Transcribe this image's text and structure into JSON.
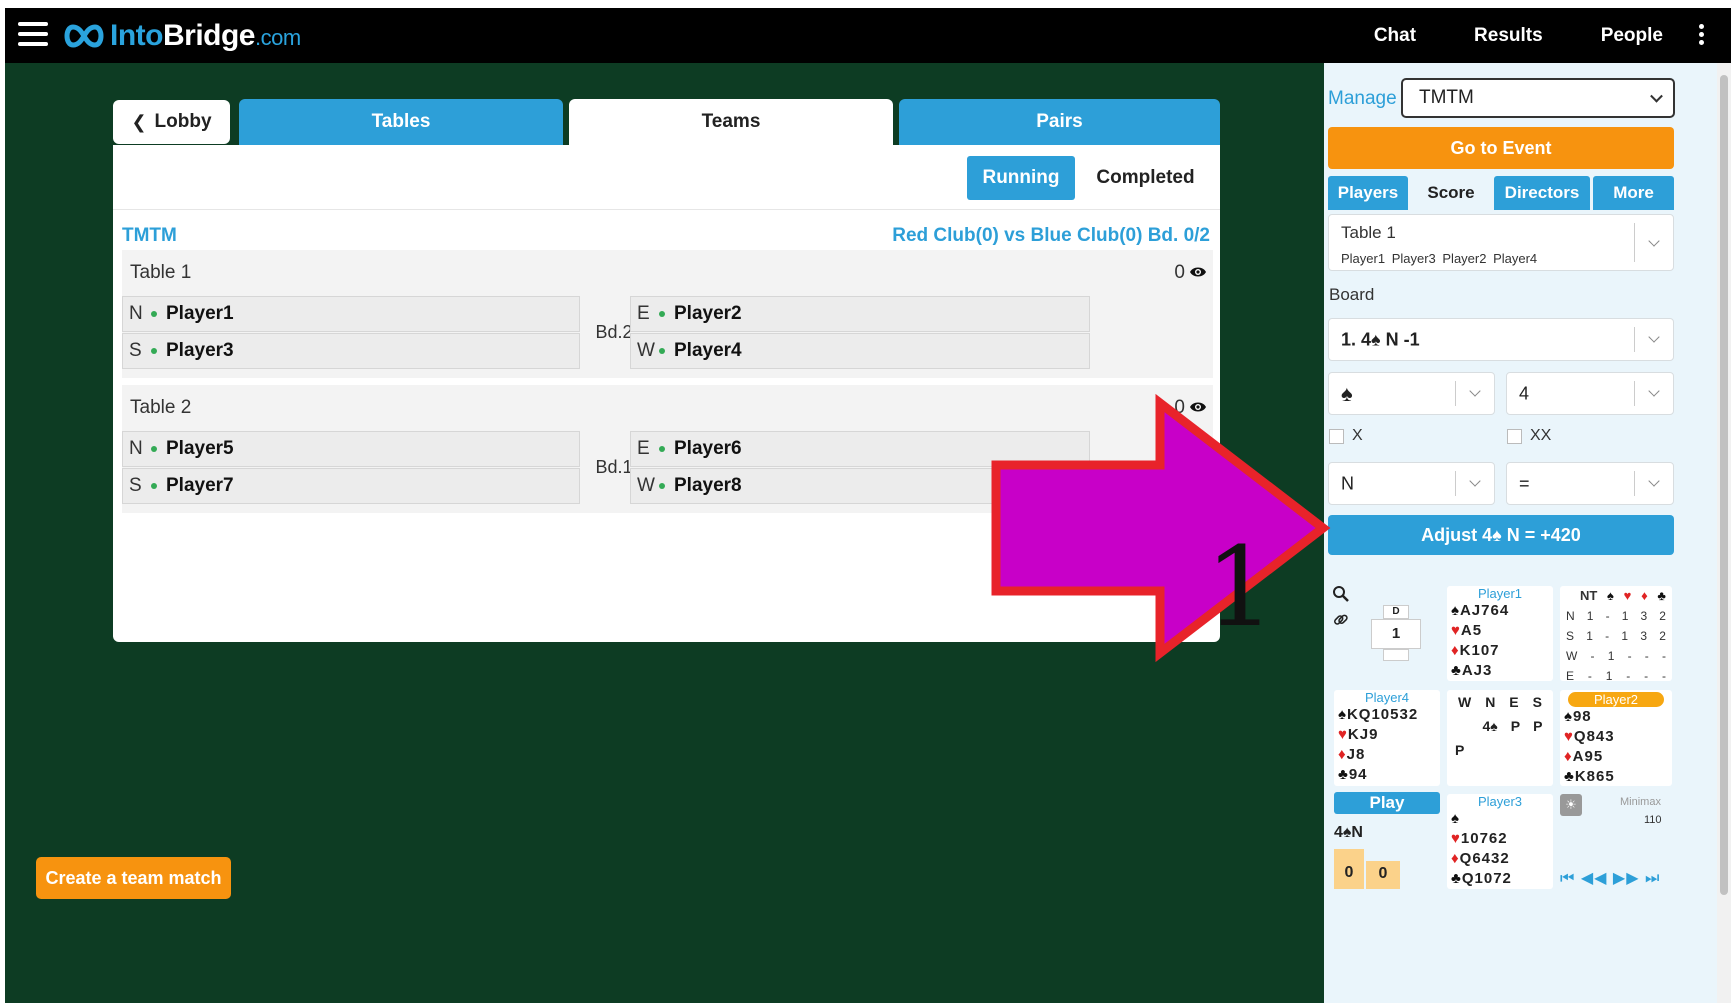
{
  "header": {
    "logo": {
      "into": "Into",
      "bridge": "Bridge",
      "domain": ".com"
    },
    "nav": [
      "Chat",
      "Results",
      "People"
    ]
  },
  "tabs": {
    "lobby": "Lobby",
    "tables": "Tables",
    "teams": "Teams",
    "pairs": "Pairs"
  },
  "filters": {
    "running": "Running",
    "completed": "Completed"
  },
  "event": {
    "name": "TMTM",
    "match": "Red Club(0) vs Blue Club(0)  Bd. 0/2"
  },
  "tables": [
    {
      "title": "Table 1",
      "score": "0",
      "board": "Bd.2",
      "n": {
        "dir": "N",
        "name": "Player1"
      },
      "s": {
        "dir": "S",
        "name": "Player3"
      },
      "e": {
        "dir": "E",
        "name": "Player2"
      },
      "w": {
        "dir": "W",
        "name": "Player4"
      }
    },
    {
      "title": "Table 2",
      "score": "0",
      "board": "Bd.1",
      "n": {
        "dir": "N",
        "name": "Player5"
      },
      "s": {
        "dir": "S",
        "name": "Player7"
      },
      "e": {
        "dir": "E",
        "name": "Player6"
      },
      "w": {
        "dir": "W",
        "name": "Player8"
      }
    }
  ],
  "create_button": "Create a team match",
  "sidebar": {
    "manage_label": "Manage",
    "manage_value": "TMTM",
    "goto_button": "Go to Event",
    "tabs": [
      "Players",
      "Score",
      "Directors",
      "More"
    ],
    "table_select": {
      "title": "Table 1",
      "players": "Player1 Player3 Player2 Player4"
    },
    "board_label": "Board",
    "board_value": "1.  4♠ N -1",
    "suit_value": "♠",
    "level_value": "4",
    "x_label": "X",
    "xx_label": "XX",
    "declarer_value": "N",
    "result_value": "=",
    "adjust_button": "Adjust  4♠ N = +420"
  },
  "mini": {
    "dealer": "D",
    "board_no": "1",
    "north": {
      "name": "Player1",
      "s": "AJ764",
      "h": "A5",
      "d": "K107",
      "c": "AJ3"
    },
    "west": {
      "name": "Player4",
      "s": "KQ10532",
      "h": "KJ9",
      "d": "J8",
      "c": "94"
    },
    "east": {
      "name": "Player2",
      "s": "98",
      "h": "Q843",
      "d": "A95",
      "c": "K865"
    },
    "south": {
      "name": "Player3",
      "s": "",
      "h": "10762",
      "d": "Q6432",
      "c": "Q1072"
    },
    "dd_header": [
      "NT",
      "♠",
      "♥",
      "♦",
      "♣"
    ],
    "dd_rows": [
      [
        "N",
        "1",
        "-",
        "1",
        "3",
        "2"
      ],
      [
        "S",
        "1",
        "-",
        "1",
        "3",
        "2"
      ],
      [
        "W",
        "-",
        "1",
        "-",
        "-",
        "-"
      ],
      [
        "E",
        "-",
        "1",
        "-",
        "-",
        "-"
      ]
    ],
    "bid_header": [
      "W",
      "N",
      "E",
      "S"
    ],
    "bid_row1": [
      "",
      "4♠",
      "P",
      "P"
    ],
    "bid_row2": [
      "P",
      "",
      "",
      ""
    ],
    "play_button": "Play",
    "contract": "4♠N",
    "tricks": [
      "0",
      "0"
    ],
    "minimax_label": "Minimax",
    "minimax_value": "110",
    "nav": "⏮ ◀◀ ▶▶ ⏭"
  },
  "annotation": {
    "label": "1",
    "fill": "#c800c8",
    "stroke": "#e8232a"
  }
}
